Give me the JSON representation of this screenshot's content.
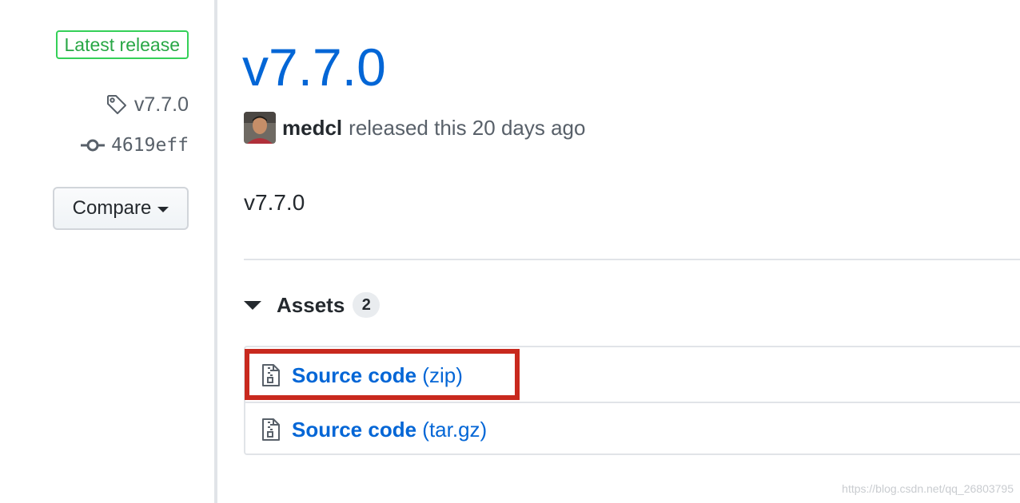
{
  "sidebar": {
    "latest_badge": "Latest release",
    "tag": "v7.7.0",
    "commit": "4619eff",
    "compare_label": "Compare"
  },
  "release": {
    "title": "v7.7.0",
    "author": "medcl",
    "released_text": "released this 20 days ago",
    "body": "v7.7.0"
  },
  "assets": {
    "label": "Assets",
    "count": "2",
    "items": [
      {
        "name": "Source code",
        "ext": "(zip)",
        "highlighted": true
      },
      {
        "name": "Source code",
        "ext": "(tar.gz)",
        "highlighted": false
      }
    ]
  },
  "watermark": "https://blog.csdn.net/qq_26803795",
  "colors": {
    "link": "#0366d6",
    "badge_green": "#28a745",
    "highlight_red": "#c8291e",
    "muted": "#586069"
  }
}
